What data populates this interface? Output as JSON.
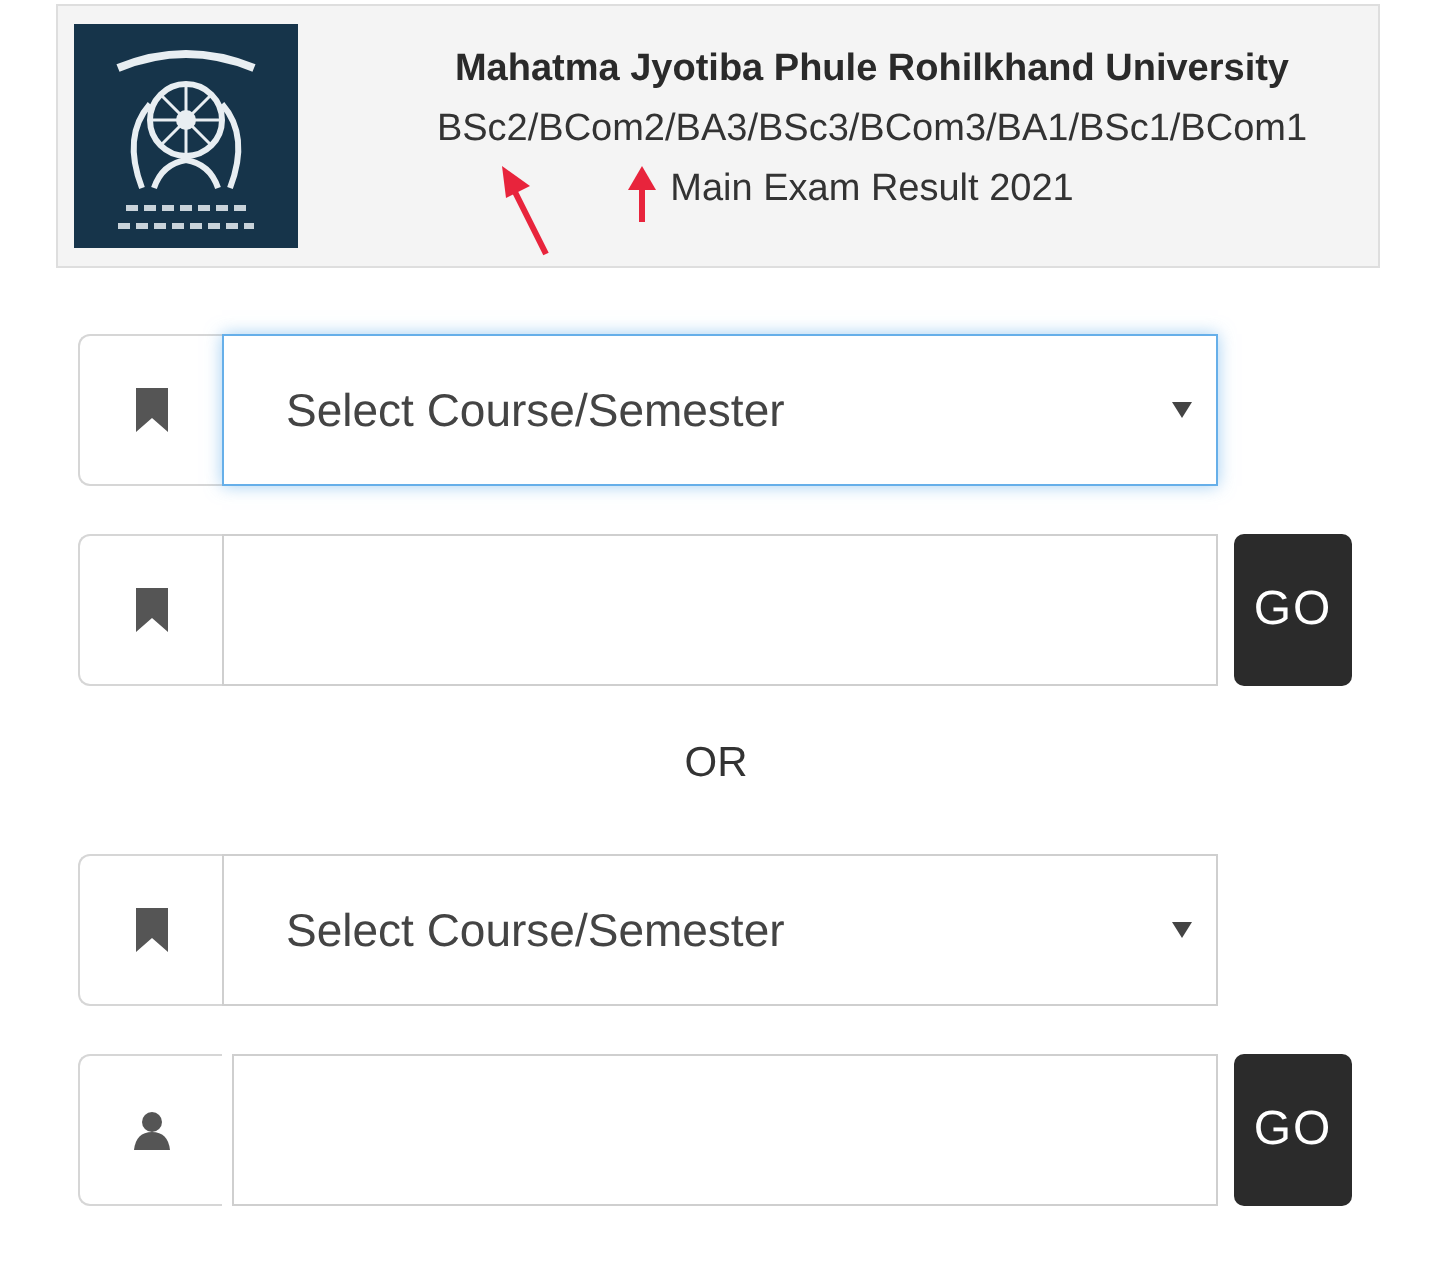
{
  "header": {
    "title": "Mahatma Jyotiba Phule Rohilkhand University",
    "courses": "BSc2/BCom2/BA3/BSc3/BCom3/BA1/BSc1/BCom1",
    "subtitle": "Main Exam Result 2021"
  },
  "groups": [
    {
      "rows": [
        {
          "kind": "select",
          "placeholder": "Select Course/Semester",
          "focused": true
        },
        {
          "kind": "code",
          "focused": false,
          "button": "GO"
        }
      ]
    },
    {
      "rows": [
        {
          "kind": "select",
          "placeholder": "Select Course/Semester",
          "focused": false
        },
        {
          "kind": "roll",
          "focused": false,
          "button": "GO"
        }
      ]
    }
  ],
  "separator": "OR"
}
